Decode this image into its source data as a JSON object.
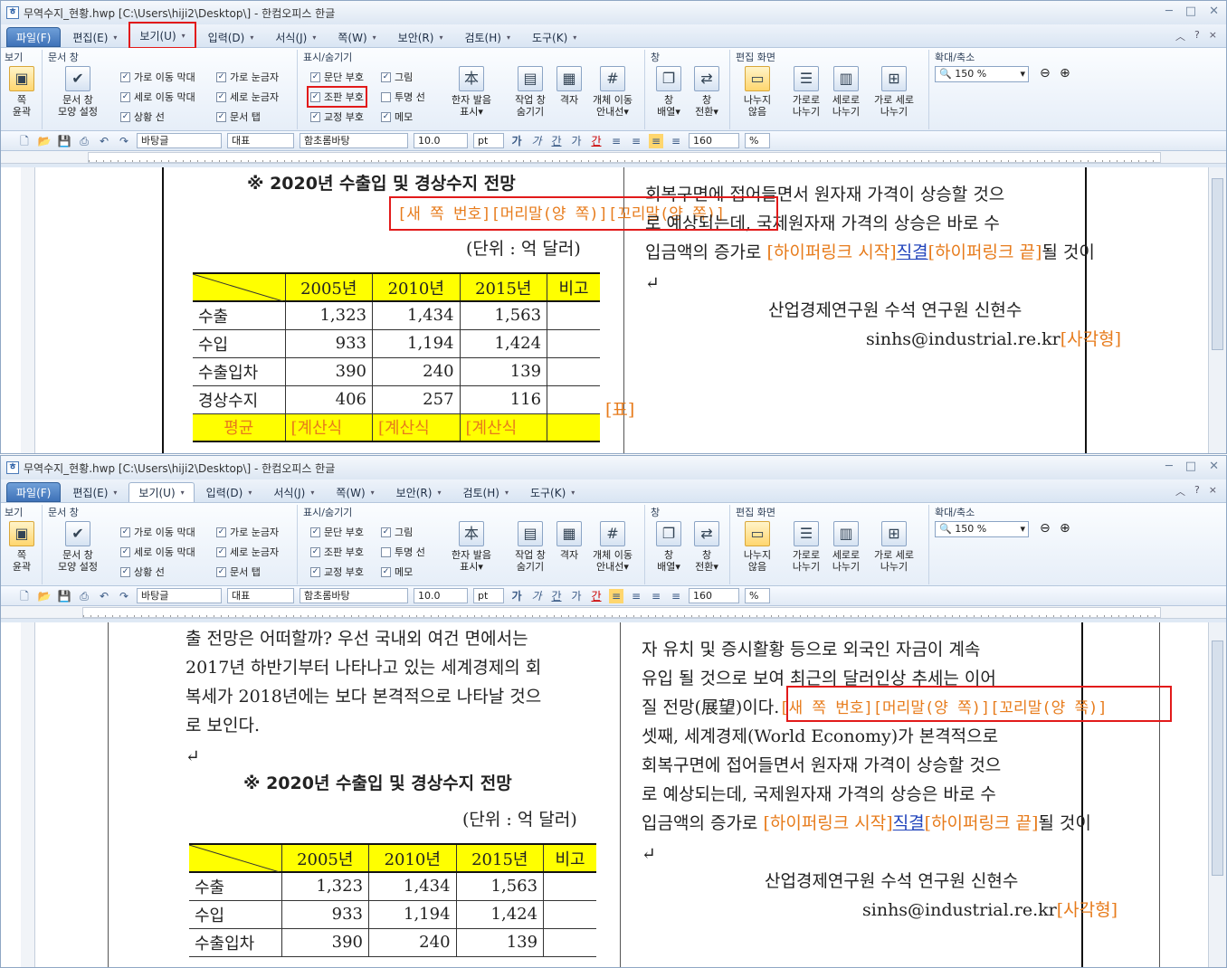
{
  "window": {
    "title": "무역수지_현황.hwp [C:\\Users\\hiji2\\Desktop\\] - 한컴오피스 한글",
    "icon": "hwp-doc-icon",
    "controls": [
      "─",
      "□",
      "✕"
    ]
  },
  "menus": [
    {
      "label": "파일(F)",
      "dd": "▾"
    },
    {
      "label": "편집(E)",
      "dd": "▾"
    },
    {
      "label": "보기(U)",
      "dd": "▾"
    },
    {
      "label": "입력(D)",
      "dd": "▾"
    },
    {
      "label": "서식(J)",
      "dd": "▾"
    },
    {
      "label": "쪽(W)",
      "dd": "▾"
    },
    {
      "label": "보안(R)",
      "dd": "▾"
    },
    {
      "label": "검토(H)",
      "dd": "▾"
    },
    {
      "label": "도구(K)",
      "dd": "▾"
    }
  ],
  "menu_right": [
    "︿",
    "?",
    "×"
  ],
  "ribbon": {
    "groups": {
      "view": "보기",
      "docwin": "문서 창",
      "showhide": "표시/숨기기",
      "window": "창",
      "editscreen": "편집 화면",
      "zoom": "확대/축소"
    },
    "outline_btn": "쪽\n윤곽",
    "docwin_btn": "문서 창\n모양 설정",
    "checks_docwin": [
      {
        "label": "가로 이동 막대",
        "checked": true
      },
      {
        "label": "가로 눈금자",
        "checked": true
      },
      {
        "label": "세로 이동 막대",
        "checked": true
      },
      {
        "label": "세로 눈금자",
        "checked": true
      },
      {
        "label": "상황 선",
        "checked": true
      },
      {
        "label": "문서 탭",
        "checked": true
      }
    ],
    "checks_show": [
      {
        "label": "문단 부호",
        "checked": true
      },
      {
        "label": "그림",
        "checked": true
      },
      {
        "label": "조판 부호",
        "checked": true
      },
      {
        "label": "투명 선",
        "checked": false
      },
      {
        "label": "교정 부호",
        "checked": true
      },
      {
        "label": "메모",
        "checked": true
      }
    ],
    "hanja_btn": "한자 발음\n표시▾",
    "task_btn": "작업 창\n숨기기",
    "grid_btn": "격자",
    "objnav_btn": "개체 이동\n안내선▾",
    "arrange_btn": "창\n배열▾",
    "switch_btn": "창\n전환▾",
    "nosplit_btn": "나누지\n않음",
    "hsplit_btn": "가로로\n나누기",
    "vsplit_btn": "세로로\n나누기",
    "hvsplit_btn": "가로 세로\n나누기",
    "zoom_value": "150 %"
  },
  "toolbar": {
    "style": "바탕글",
    "lang": "대표",
    "font": "함초롬바탕",
    "size": "10.0",
    "unit": "pt",
    "fmt": [
      "가",
      "가",
      "간",
      "가",
      "간"
    ],
    "spacing": "160",
    "spacing_unit": "%"
  },
  "doc1": {
    "heading": "※ 2020년 수출입 및 경상수지 전망",
    "marker": "[새 쪽 번호][머리말(양 쪽)][꼬리말(양 쪽)]",
    "unit": "(단위 : 억 달러)",
    "right_lines": [
      "회복구면에 접어들면서 원자재 가격이 상승할 것으",
      "로 예상되는데, 국제원자재 가격의 상승은 바로 수"
    ],
    "right_line3a": "입금액의 증가로 ",
    "hl_start": "[하이퍼링크 시작]",
    "hl_word": "직결",
    "hl_end": "[하이퍼링크 끝]",
    "right_line3b": "될 것이",
    "author": "산업경제연구원 수석 연구원 신현수",
    "email": "sinhs@industrial.re.kr",
    "shape_tag": "[사각형]",
    "table_tag": "[표]"
  },
  "doc2": {
    "left_lines": [
      "출 전망은 어떠할까? 우선 국내외 여건 면에서는",
      "2017년 하반기부터 나타나고 있는 세계경제의 회",
      "복세가 2018년에는 보다 본격적으로 나타날 것으",
      "로 보인다."
    ],
    "heading": "※ 2020년 수출입 및 경상수지 전망",
    "unit": "(단위 : 억 달러)",
    "right_lines": [
      "자 유치 및 증시활황 등으로 외국인 자금이 계속",
      "유입 될 것으로 보여 최근의 달러인상 추세는 이어"
    ],
    "right_line3": "질 전망(展望)이다.",
    "marker": "[새 쪽 번호][머리말(양 쪽)][꼬리말(양 쪽)]",
    "right_lines2": [
      "  셋째, 세계경제(World Economy)가 본격적으로",
      "회복구면에 접어들면서 원자재 가격이 상승할 것으",
      "로 예상되는데, 국제원자재 가격의 상승은 바로 수"
    ],
    "right_line7a": "입금액의 증가로 ",
    "hl_start": "[하이퍼링크 시작]",
    "hl_word": "직결",
    "hl_end": "[하이퍼링크 끝]",
    "right_line7b": "될 것이",
    "author": "산업경제연구원 수석 연구원 신현수",
    "email": "sinhs@industrial.re.kr",
    "shape_tag": "[사각형]"
  },
  "table": {
    "headers": [
      "2005년",
      "2010년",
      "2015년",
      "비고"
    ],
    "rows": [
      {
        "label": "수출",
        "values": [
          "1,323",
          "1,434",
          "1,563"
        ]
      },
      {
        "label": "수입",
        "values": [
          "933",
          "1,194",
          "1,424"
        ]
      },
      {
        "label": "수출입차",
        "values": [
          "390",
          "240",
          "139"
        ]
      },
      {
        "label": "경상수지",
        "values": [
          "406",
          "257",
          "116"
        ]
      }
    ],
    "avg": {
      "label": "평균",
      "values": [
        "[계산식",
        "[계산식",
        "[계산식"
      ]
    }
  },
  "para_mark": "↵"
}
